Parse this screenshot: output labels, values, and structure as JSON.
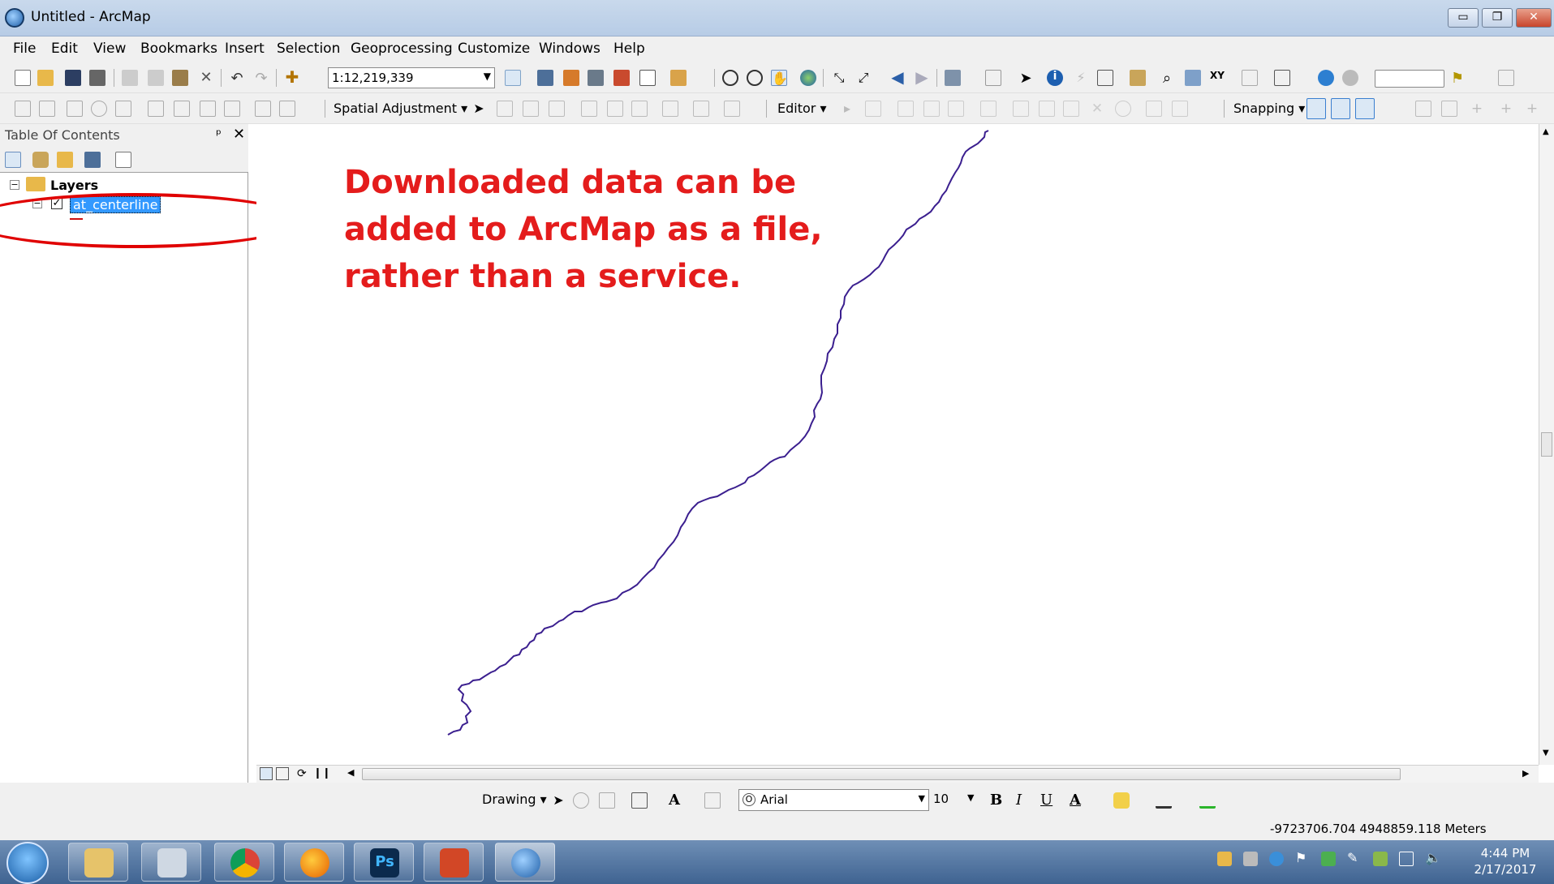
{
  "window": {
    "title": "Untitled - ArcMap",
    "controls": {
      "minimize": "▭",
      "maximize": "❐",
      "close": "✕"
    }
  },
  "menu": [
    "File",
    "Edit",
    "View",
    "Bookmarks",
    "Insert",
    "Selection",
    "Geoprocessing",
    "Customize",
    "Windows",
    "Help"
  ],
  "toolbar": {
    "scale": "1:12,219,339",
    "spatial_adjustment": "Spatial Adjustment ▾",
    "editor": "Editor ▾",
    "snapping": "Snapping ▾"
  },
  "toc": {
    "title": "Table Of Contents",
    "pin": "ᵖ",
    "close": "✕",
    "root": "Layers",
    "layer": "at_centerline"
  },
  "map": {
    "annotation": "Downloaded data can be added to ArcMap as a file, rather than a service.",
    "line_color": "#3b1f8f",
    "annotation_color": "#e41c1c"
  },
  "drawing": {
    "label": "Drawing ▾",
    "font": "Arial",
    "size": "10",
    "bold": "B",
    "italic": "I",
    "underline": "U",
    "text_tool": "A"
  },
  "status": {
    "coordinates": "-9723706.704  4948859.118 Meters"
  },
  "taskbar": {
    "apps": [
      "explorer",
      "calculator",
      "chrome",
      "firefox",
      "photoshop",
      "powerpoint",
      "arcmap"
    ],
    "photoshop_label": "Ps",
    "time": "4:44 PM",
    "date": "2/17/2017"
  }
}
